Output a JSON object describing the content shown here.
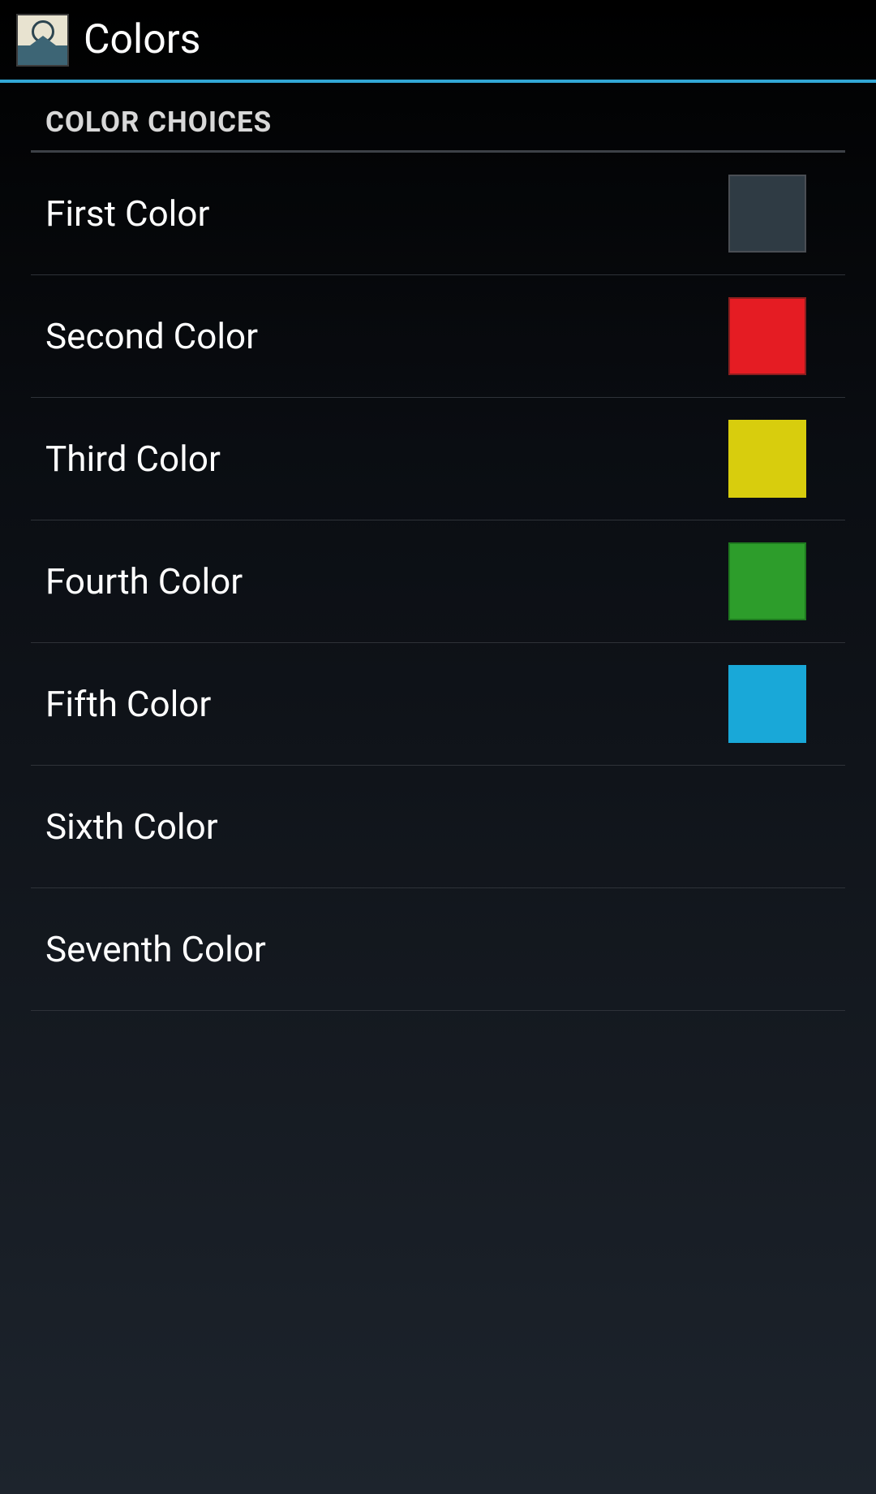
{
  "header": {
    "title": "Colors"
  },
  "section": {
    "title": "COLOR CHOICES"
  },
  "colors": [
    {
      "label": "First Color",
      "swatch": "swatch-dark",
      "hex": "#2f3b44"
    },
    {
      "label": "Second Color",
      "swatch": "swatch-red",
      "hex": "#e51c23"
    },
    {
      "label": "Third Color",
      "swatch": "swatch-yellow",
      "hex": "#d8cd0d"
    },
    {
      "label": "Fourth Color",
      "swatch": "swatch-green",
      "hex": "#2d9d2b"
    },
    {
      "label": "Fifth Color",
      "swatch": "swatch-blue",
      "hex": "#19a8d8"
    },
    {
      "label": "Sixth Color",
      "swatch": null,
      "hex": null
    },
    {
      "label": "Seventh Color",
      "swatch": null,
      "hex": null
    }
  ]
}
